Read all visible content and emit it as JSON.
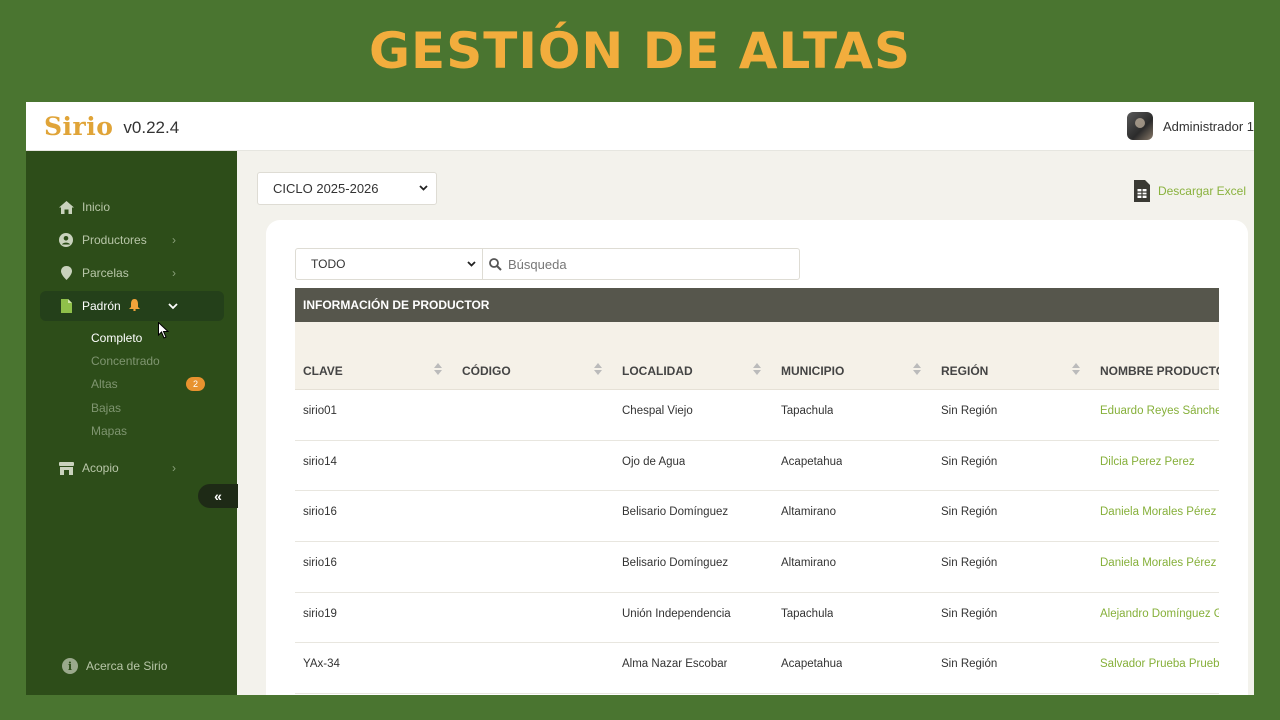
{
  "banner": {
    "title": "GESTIÓN DE ALTAS"
  },
  "app": {
    "logo": "Sirio",
    "version": "v0.22.4",
    "user": "Administrador 1"
  },
  "sidebar": {
    "items": [
      {
        "label": "Inicio",
        "icon": "home-icon"
      },
      {
        "label": "Productores",
        "icon": "user-circle-icon"
      },
      {
        "label": "Parcelas",
        "icon": "map-pin-icon"
      },
      {
        "label": "Padrón",
        "icon": "file-icon"
      },
      {
        "label": "Acopio",
        "icon": "store-icon"
      }
    ],
    "padron_sub": [
      {
        "label": "Completo"
      },
      {
        "label": "Concentrado"
      },
      {
        "label": "Altas",
        "badge": "2"
      },
      {
        "label": "Bajas"
      },
      {
        "label": "Mapas"
      }
    ],
    "collapse": "«",
    "about": "Acerca de Sirio"
  },
  "toolbar": {
    "cycle": "CICLO 2025-2026",
    "excel": "Descargar Excel"
  },
  "filters": {
    "scope": "TODO",
    "search_placeholder": "Búsqueda"
  },
  "table": {
    "group_header": "INFORMACIÓN DE PRODUCTOR",
    "columns": [
      "CLAVE",
      "CÓDIGO",
      "LOCALIDAD",
      "MUNICIPIO",
      "REGIÓN",
      "NOMBRE PRODUCTOR"
    ],
    "rows": [
      [
        "sirio01",
        "",
        "Chespal Viejo",
        "Tapachula",
        "Sin Región",
        "Eduardo Reyes Sánchez"
      ],
      [
        "sirio14",
        "",
        "Ojo de Agua",
        "Acapetahua",
        "Sin Región",
        "Dilcia Perez Perez"
      ],
      [
        "sirio16",
        "",
        "Belisario Domínguez",
        "Altamirano",
        "Sin Región",
        "Daniela Morales Pérez"
      ],
      [
        "sirio16",
        "",
        "Belisario Domínguez",
        "Altamirano",
        "Sin Región",
        "Daniela Morales Pérez"
      ],
      [
        "sirio19",
        "",
        "Unión Independencia",
        "Tapachula",
        "Sin Región",
        "Alejandro Domínguez G"
      ],
      [
        "YAx-34",
        "",
        "Alma Nazar Escobar",
        "Acapetahua",
        "Sin Región",
        "Salvador Prueba Prueba"
      ]
    ]
  }
}
